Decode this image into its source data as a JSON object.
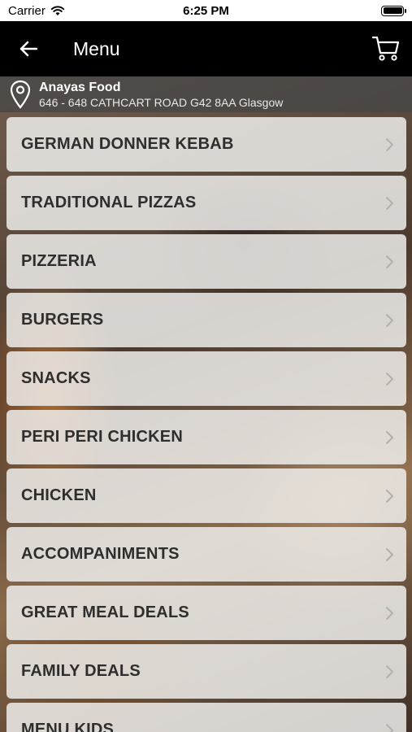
{
  "status_bar": {
    "carrier": "Carrier",
    "time": "6:25 PM"
  },
  "header": {
    "title": "Menu",
    "back_icon": "arrow-left-icon",
    "cart_icon": "cart-icon"
  },
  "restaurant": {
    "name": "Anayas Food",
    "address": "646 - 648 CATHCART ROAD G42 8AA Glasgow"
  },
  "menu": {
    "items": [
      {
        "label": "GERMAN DONNER KEBAB"
      },
      {
        "label": "TRADITIONAL PIZZAS"
      },
      {
        "label": "PIZZERIA"
      },
      {
        "label": "BURGERS"
      },
      {
        "label": "SNACKS"
      },
      {
        "label": "PERI PERI CHICKEN"
      },
      {
        "label": "CHICKEN"
      },
      {
        "label": "ACCOMPANIMENTS"
      },
      {
        "label": "GREAT MEAL DEALS"
      },
      {
        "label": "FAMILY DEALS"
      },
      {
        "label": "MENU KIDS"
      }
    ]
  },
  "colors": {
    "navbar": "#000000",
    "item_bg": "#eeecea",
    "item_text": "#2e2e2e"
  }
}
